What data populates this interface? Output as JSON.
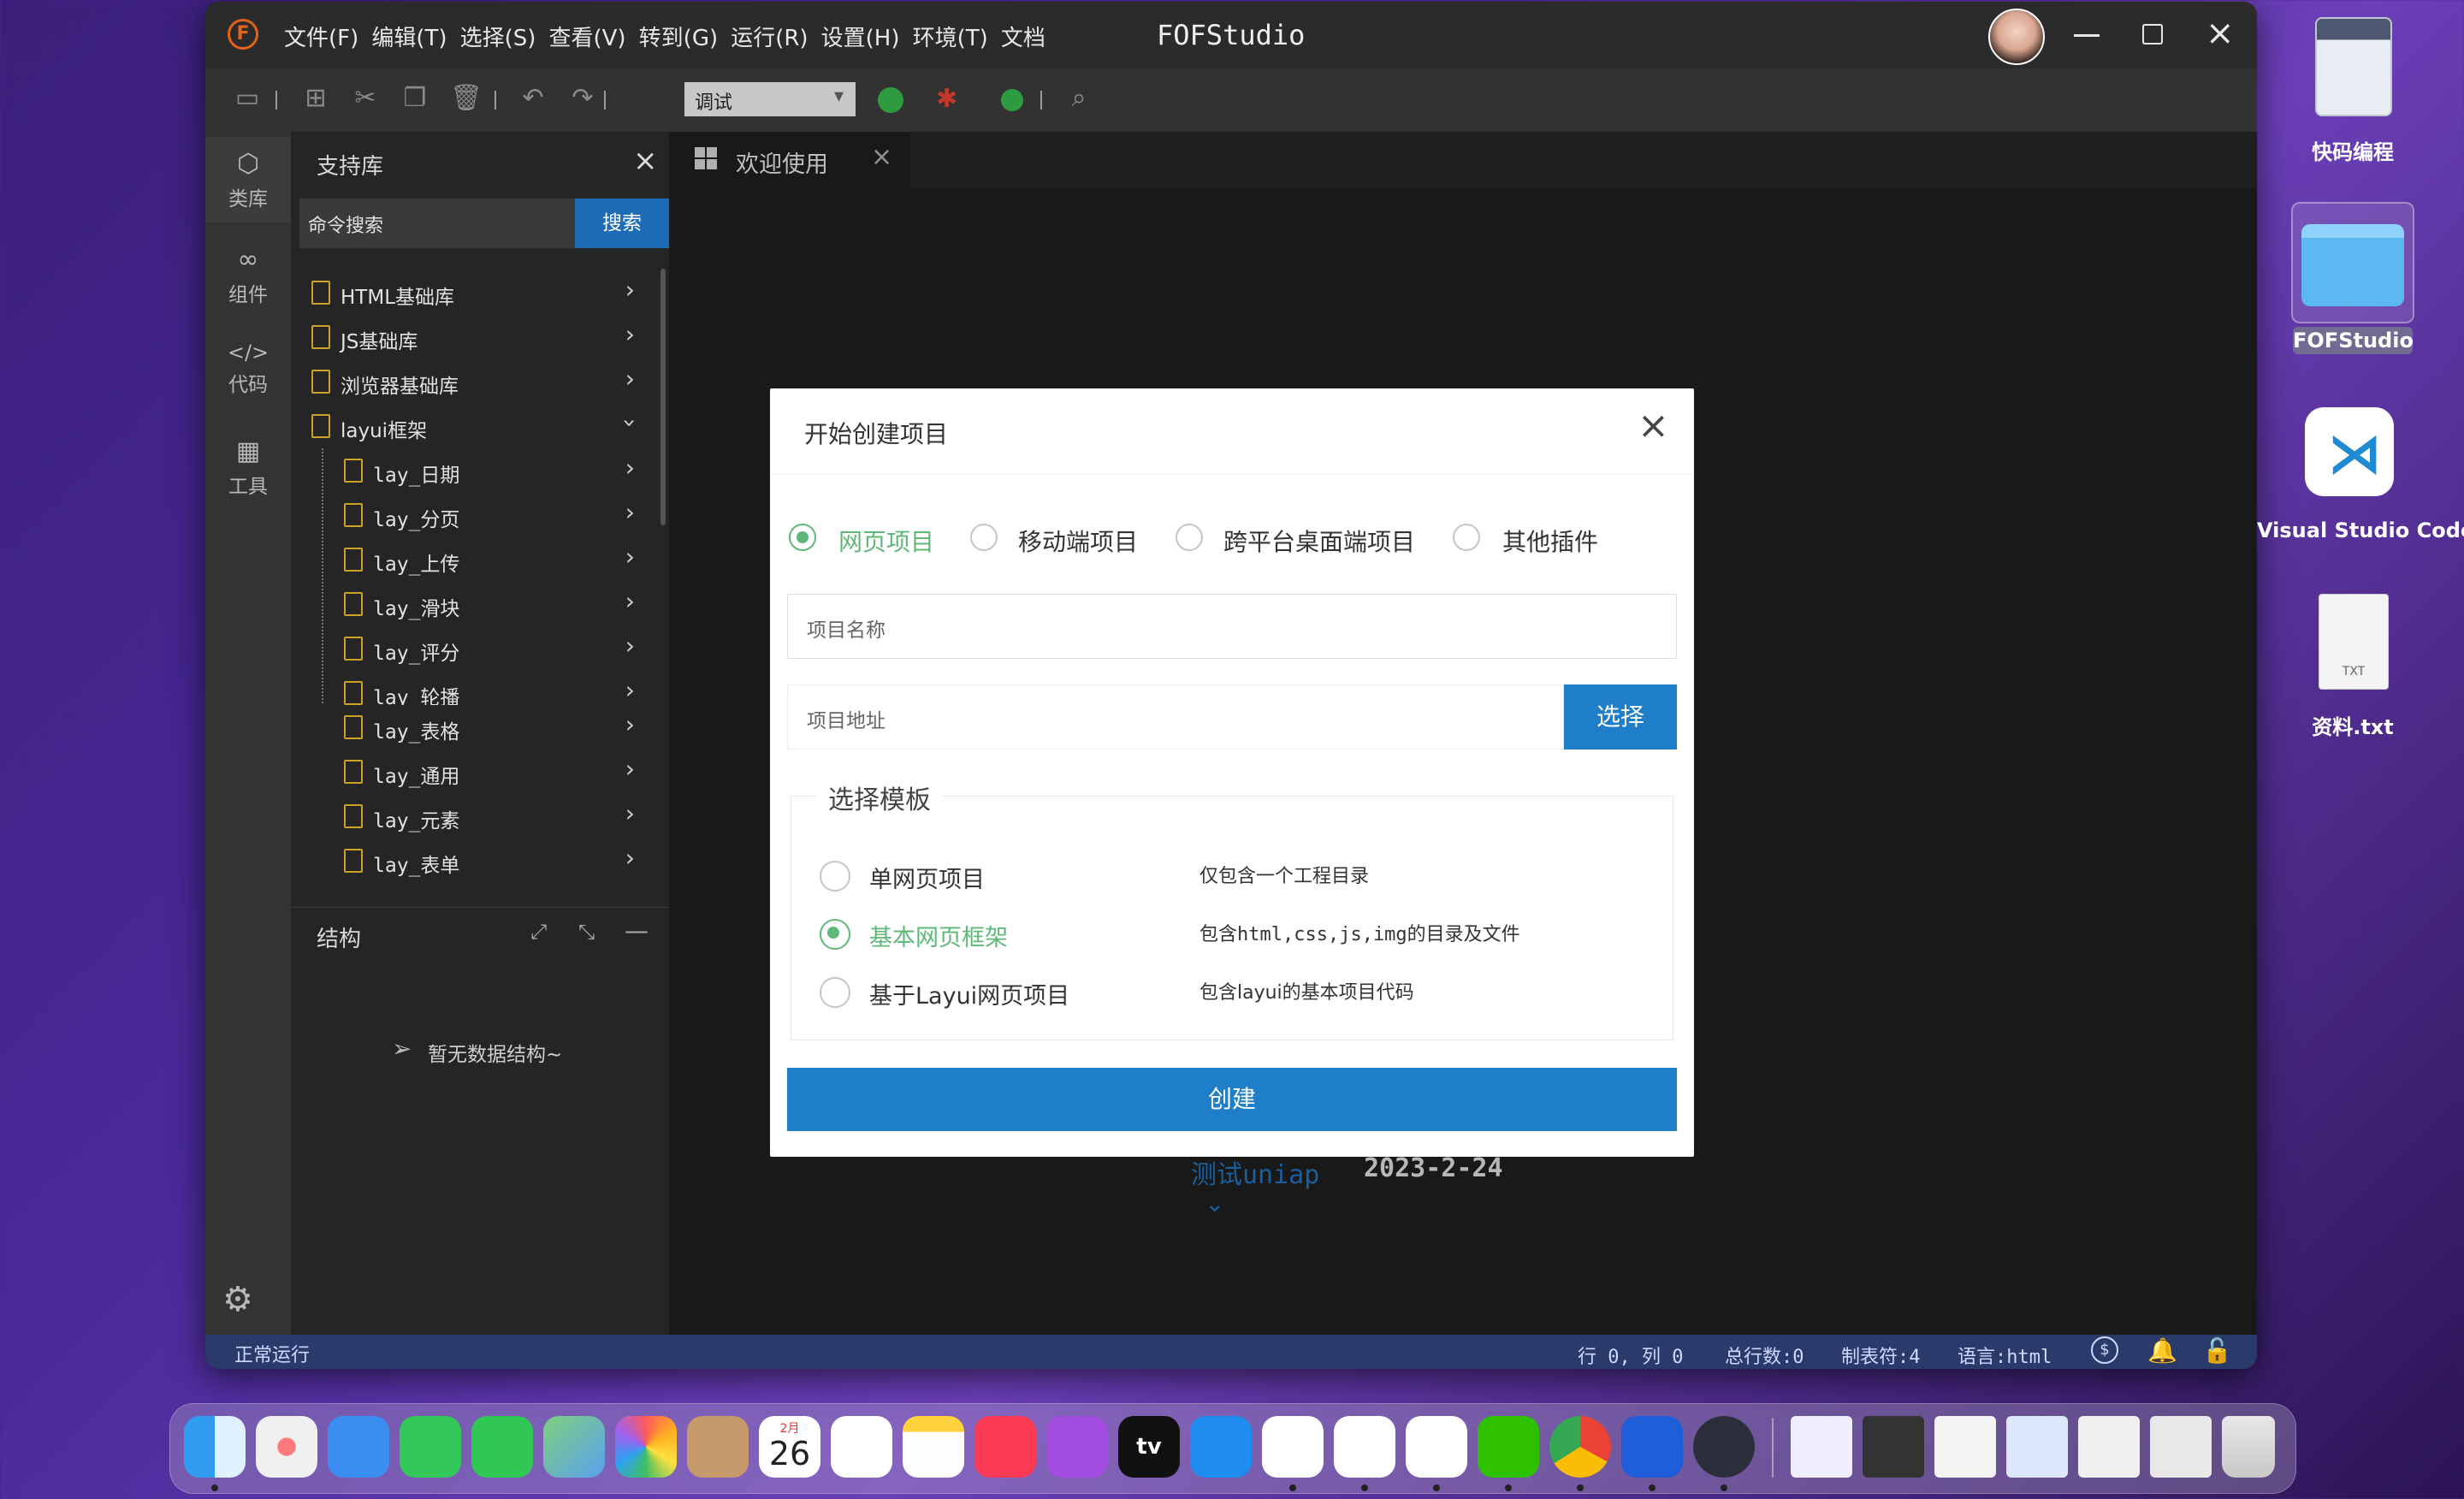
{
  "window": {
    "app_logo": "F",
    "menu": [
      "文件(F)",
      "编辑(T)",
      "选择(S)",
      "查看(V)",
      "转到(G)",
      "运行(R)",
      "设置(H)",
      "环境(T)",
      "文档"
    ],
    "title": "FOFStudio"
  },
  "toolbar": {
    "mode_select": "调试"
  },
  "activity": {
    "items": [
      {
        "label": "类库",
        "icon": "cube-icon"
      },
      {
        "label": "组件",
        "icon": "link-icon"
      },
      {
        "label": "代码",
        "icon": "code-icon"
      },
      {
        "label": "工具",
        "icon": "tools-icon"
      }
    ]
  },
  "library": {
    "title": "支持库",
    "search_placeholder": "命令搜索",
    "search_button": "搜索",
    "items": [
      {
        "label": "HTML基础库",
        "level": 0,
        "expanded": false
      },
      {
        "label": "JS基础库",
        "level": 0,
        "expanded": false
      },
      {
        "label": "浏览器基础库",
        "level": 0,
        "expanded": false
      },
      {
        "label": "layui框架",
        "level": 0,
        "expanded": true
      },
      {
        "label": "lay_日期",
        "level": 1,
        "expanded": false
      },
      {
        "label": "lay_分页",
        "level": 1,
        "expanded": false
      },
      {
        "label": "lay_上传",
        "level": 1,
        "expanded": false
      },
      {
        "label": "lay_滑块",
        "level": 1,
        "expanded": false
      },
      {
        "label": "lay_评分",
        "level": 1,
        "expanded": false
      },
      {
        "label": "lay_轮播",
        "level": 1,
        "expanded": false
      },
      {
        "label": "lay_表格",
        "level": 1,
        "expanded": false
      },
      {
        "label": "lay_通用",
        "level": 1,
        "expanded": false
      },
      {
        "label": "lay_元素",
        "level": 1,
        "expanded": false
      },
      {
        "label": "lay_表单",
        "level": 1,
        "expanded": false
      }
    ]
  },
  "structure": {
    "title": "结构",
    "empty_text": "暂无数据结构~"
  },
  "editor": {
    "tab_label": "欢迎使用",
    "recent_name": "测试uniap",
    "recent_date": "2023-2-24"
  },
  "modal": {
    "title": "开始创建项目",
    "project_types": [
      {
        "label": "网页项目",
        "selected": true
      },
      {
        "label": "移动端项目",
        "selected": false
      },
      {
        "label": "跨平台桌面端项目",
        "selected": false
      },
      {
        "label": "其他插件",
        "selected": false
      }
    ],
    "name_placeholder": "项目名称",
    "path_placeholder": "项目地址",
    "choose_button": "选择",
    "template_legend": "选择模板",
    "templates": [
      {
        "label": "单网页项目",
        "desc": "仅包含一个工程目录",
        "selected": false
      },
      {
        "label": "基本网页框架",
        "desc": "包含html,css,js,img的目录及文件",
        "selected": true
      },
      {
        "label": "基于Layui网页项目",
        "desc": "包含layui的基本项目代码",
        "selected": false
      }
    ],
    "create_button": "创建"
  },
  "status": {
    "left": "正常运行",
    "position": "行 0, 列 0",
    "total_lines": "总行数:0",
    "tab": "制表符:4",
    "language": "语言:html"
  },
  "desktop": {
    "icons": [
      {
        "label": "快码编程"
      },
      {
        "label": "FOFStudio"
      },
      {
        "label": "Visual Studio Code"
      },
      {
        "label": "资料.txt",
        "badge": "TXT"
      }
    ]
  },
  "dock": {
    "calendar_month": "2月",
    "calendar_day": "26",
    "tv_label": "tv"
  },
  "colors": {
    "accent_green": "#5fb878",
    "primary_blue": "#1e7ec8",
    "status_bar": "#2a3a6a"
  }
}
